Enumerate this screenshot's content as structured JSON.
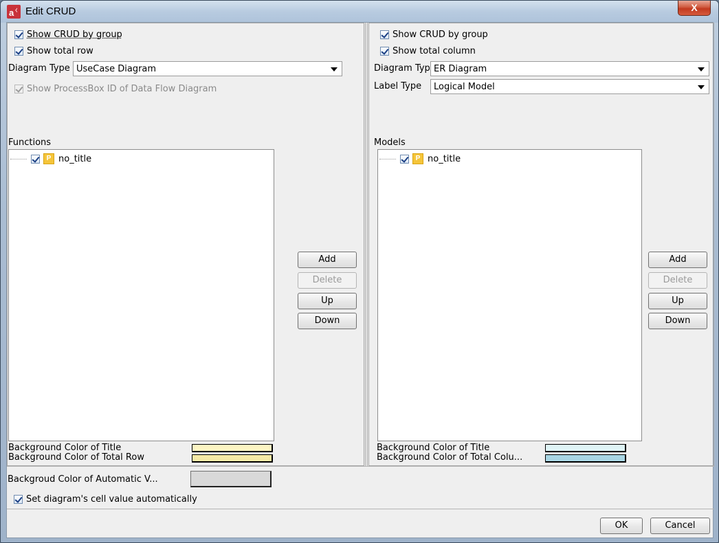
{
  "window": {
    "title": "Edit CRUD",
    "close_glyph": "X",
    "icon": "astah-app-icon"
  },
  "left": {
    "show_crud_by_group": {
      "label": "Show CRUD by group",
      "checked": true
    },
    "show_total_row": {
      "label": "Show total row",
      "checked": true
    },
    "diagram_type": {
      "label": "Diagram Type",
      "value": "UseCase Diagram"
    },
    "show_processbox": {
      "label": "Show ProcessBox ID of Data Flow Diagram",
      "checked": true,
      "disabled": true
    },
    "list_title": "Functions",
    "tree": [
      {
        "label": "no_title",
        "checked": true,
        "icon_letter": "P"
      }
    ],
    "buttons": {
      "add": "Add",
      "delete": "Delete",
      "up": "Up",
      "down": "Down"
    },
    "bg_title": {
      "label": "Background Color of Title",
      "color": "#fdf5c3"
    },
    "bg_total": {
      "label": "Background Color of Total Row",
      "color": "#f5e9a6"
    }
  },
  "right": {
    "show_crud_by_group": {
      "label": "Show CRUD by group",
      "checked": true
    },
    "show_total_column": {
      "label": "Show total column",
      "checked": true
    },
    "diagram_type": {
      "label": "Diagram Type",
      "value": "ER Diagram"
    },
    "label_type": {
      "label": "Label Type",
      "value": "Logical Model"
    },
    "list_title": "Models",
    "tree": [
      {
        "label": "no_title",
        "checked": true,
        "icon_letter": "P"
      }
    ],
    "buttons": {
      "add": "Add",
      "delete": "Delete",
      "up": "Up",
      "down": "Down"
    },
    "bg_title": {
      "label": "Background Color of Title",
      "color": "#dff4f6"
    },
    "bg_total": {
      "label": "Background Color of Total Colu...",
      "color": "#a9d6e4"
    }
  },
  "bottom": {
    "auto_bg": {
      "label": "Backgroud Color of Automatic V...",
      "color": "#d9d9d9"
    },
    "set_auto": {
      "label": "Set diagram's cell value automatically",
      "checked": true
    },
    "ok": "OK",
    "cancel": "Cancel"
  }
}
